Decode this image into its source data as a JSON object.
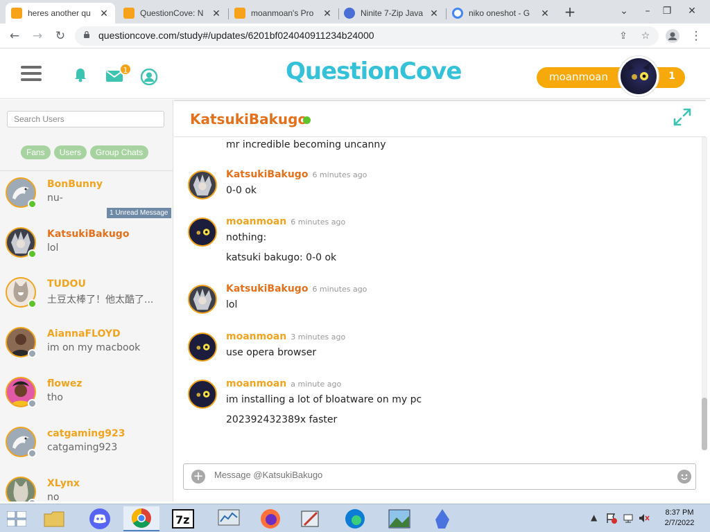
{
  "browser": {
    "tabs": [
      {
        "title": "heres another qu",
        "icon_color": "#f7a21b",
        "active": true
      },
      {
        "title": "QuestionCove: N",
        "icon_color": "#f7a21b",
        "active": false
      },
      {
        "title": "moanmoan's Pro",
        "icon_color": "#f7a21b",
        "active": false
      },
      {
        "title": "Ninite 7-Zip Java",
        "icon_color": "#4a6fd4",
        "active": false
      },
      {
        "title": "niko oneshot - G",
        "icon_color": "#ffffff",
        "active": false
      }
    ],
    "close_glyph": "✕",
    "new_tab_glyph": "+",
    "url": "questioncove.com/study#/updates/6201bf024040911234b24000"
  },
  "header": {
    "logo_text": "QuestionCove",
    "notification_badge": "1",
    "username": "moanmoan",
    "points": "1"
  },
  "sidebar": {
    "search_placeholder": "Search Users",
    "filters": [
      "Fans",
      "Users",
      "Group Chats"
    ],
    "contacts": [
      {
        "name": "BonBunny",
        "preview": "nu-",
        "status": "online",
        "name_color": "#f0a41f",
        "unread": "1 Unread Message"
      },
      {
        "name": "KatsukiBakugo",
        "preview": "lol",
        "status": "online",
        "name_color": "#e3711b"
      },
      {
        "name": "TUDOU",
        "preview": "土豆太棒了！他太酷了...",
        "status": "online",
        "name_color": "#f0a41f"
      },
      {
        "name": "AiannaFLOYD",
        "preview": "im on my macbook",
        "status": "offline",
        "name_color": "#f0a41f"
      },
      {
        "name": "flowez",
        "preview": "tho",
        "status": "offline",
        "name_color": "#f0a41f"
      },
      {
        "name": "catgaming923",
        "preview": "catgaming923",
        "status": "offline",
        "name_color": "#f0a41f"
      },
      {
        "name": "XLynx",
        "preview": "no",
        "status": "offline",
        "name_color": "#f0a41f"
      }
    ]
  },
  "chat": {
    "title": "KatsukiBakugo",
    "partial_line": "mr incredible becoming uncanny",
    "messages": [
      {
        "author": "KatsukiBakugo",
        "time": "6 minutes ago",
        "lines": [
          "0-0 ok"
        ],
        "color": "#e3711b"
      },
      {
        "author": "moanmoan",
        "time": "6 minutes ago",
        "lines": [
          "nothing:",
          "katsuki bakugo: 0-0 ok"
        ],
        "color": "#f0a41f"
      },
      {
        "author": "KatsukiBakugo",
        "time": "6 minutes ago",
        "lines": [
          "lol"
        ],
        "color": "#e3711b"
      },
      {
        "author": "moanmoan",
        "time": "3 minutes ago",
        "lines": [
          "use opera browser"
        ],
        "color": "#f0a41f"
      },
      {
        "author": "moanmoan",
        "time": "a minute ago",
        "lines": [
          "im installing a lot of bloatware on my pc",
          "202392432389x faster"
        ],
        "color": "#f0a41f"
      }
    ],
    "composer_placeholder": "Message @KatsukiBakugo"
  },
  "taskbar": {
    "time": "8:37 PM",
    "date": "2/7/2022"
  },
  "colors": {
    "online": "#5dc42c",
    "offline": "#9aa6b2",
    "accent": "#f7a80a"
  }
}
